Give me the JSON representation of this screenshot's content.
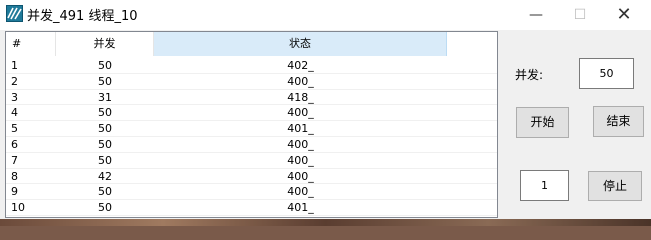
{
  "window": {
    "title": "并发_491 线程_10",
    "minimize_glyph": "—",
    "maximize_glyph": "☐",
    "close_glyph": "✕"
  },
  "table": {
    "columns": [
      "#",
      "并发",
      "状态"
    ],
    "rows": [
      [
        "1",
        "50",
        "402_"
      ],
      [
        "2",
        "50",
        "400_"
      ],
      [
        "3",
        "31",
        "418_"
      ],
      [
        "4",
        "50",
        "400_"
      ],
      [
        "5",
        "50",
        "401_"
      ],
      [
        "6",
        "50",
        "400_"
      ],
      [
        "7",
        "50",
        "400_"
      ],
      [
        "8",
        "42",
        "400_"
      ],
      [
        "9",
        "50",
        "400_"
      ],
      [
        "10",
        "50",
        "401_"
      ]
    ]
  },
  "controls": {
    "concurrency_label": "并发:",
    "concurrency_value": "50",
    "start_label": "开始",
    "end_label": "结束",
    "stop_count_value": "1",
    "stop_label": "停止"
  },
  "colors": {
    "selected_header": "#d9ebf9",
    "window_bg": "#f0f0f0"
  },
  "icons": {
    "app": "app-logo-icon"
  }
}
